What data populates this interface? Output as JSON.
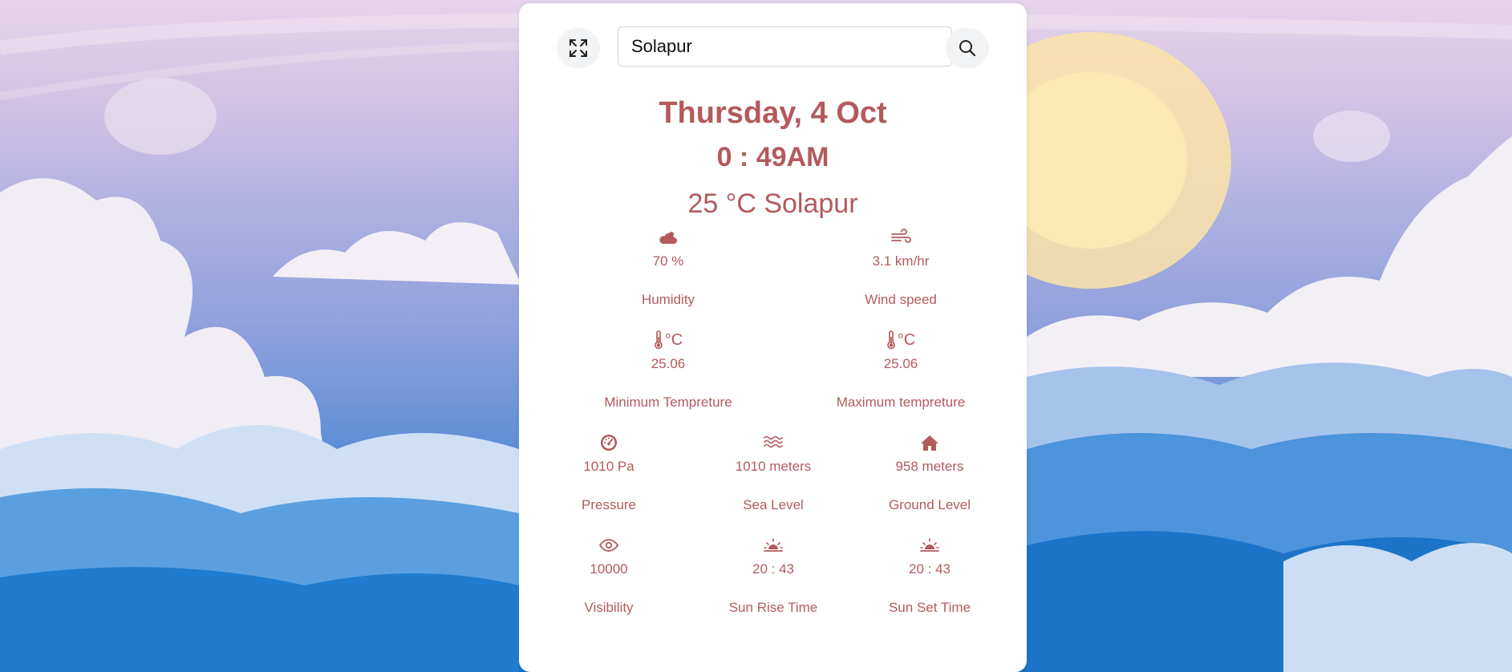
{
  "search": {
    "value": "Solapur"
  },
  "header": {
    "date": "Thursday, 4 Oct",
    "time": "0 : 49AM",
    "temp_city": "25 °C Solapur"
  },
  "colors": {
    "accent": "#b35a5c",
    "card": "#ffffff"
  },
  "row1": [
    {
      "icon": "cloud-icon",
      "value": "70 %",
      "label": "Humidity"
    },
    {
      "icon": "wind-icon",
      "value": "3.1 km/hr",
      "label": "Wind speed"
    }
  ],
  "row2": [
    {
      "icon": "thermometer-icon",
      "unit": "°C",
      "value": "25.06",
      "label": "Minimum Tempreture"
    },
    {
      "icon": "thermometer-icon",
      "unit": "°C",
      "value": "25.06",
      "label": "Maximum tempreture"
    }
  ],
  "row3": [
    {
      "icon": "gauge-icon",
      "value": "1010 Pa",
      "label": "Pressure"
    },
    {
      "icon": "water-icon",
      "value": "1010 meters",
      "label": "Sea Level"
    },
    {
      "icon": "house-icon",
      "value": "958 meters",
      "label": "Ground Level"
    }
  ],
  "row4": [
    {
      "icon": "eye-icon",
      "value": "10000",
      "label": "Visibility"
    },
    {
      "icon": "sunrise-icon",
      "value": "20 : 43",
      "label": "Sun Rise Time"
    },
    {
      "icon": "sunset-icon",
      "value": "20 : 43",
      "label": "Sun Set Time"
    }
  ]
}
